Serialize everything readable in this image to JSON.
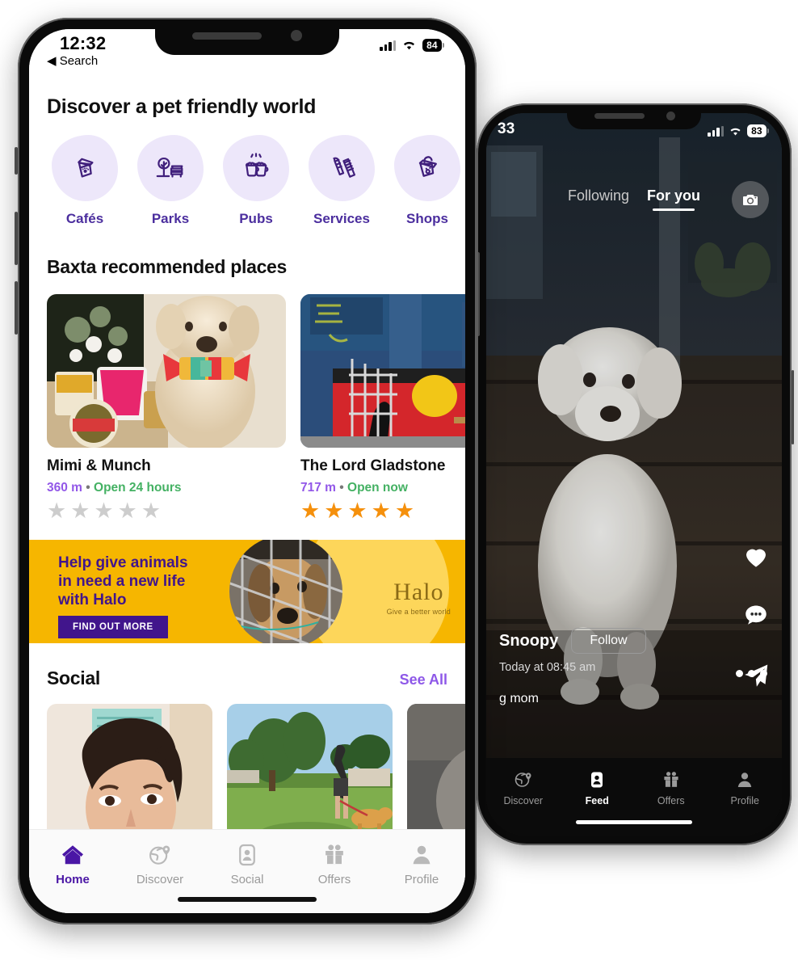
{
  "phone1": {
    "status": {
      "time": "12:32",
      "back_label": "◀ Search",
      "battery": "84",
      "wifi_icon": "wifi-icon",
      "signal_icon": "cellular-signal-icon"
    },
    "header_title": "Discover a pet friendly world",
    "categories": [
      {
        "label": "Cafés",
        "icon": "coffee-cup-paw-icon"
      },
      {
        "label": "Parks",
        "icon": "tree-bench-icon"
      },
      {
        "label": "Pubs",
        "icon": "beer-cheers-icon"
      },
      {
        "label": "Services",
        "icon": "grooming-brush-comb-icon"
      },
      {
        "label": "Shops",
        "icon": "shopping-bag-face-icon"
      }
    ],
    "recommended_title": "Baxta recommended places",
    "places": [
      {
        "name": "Mimi & Munch",
        "distance": "360 m",
        "separator": "•",
        "status": "Open 24 hours",
        "rating": 0,
        "image_alt": "white-poodle-with-rainbow-bowtie"
      },
      {
        "name": "The Lord Gladstone",
        "distance": "717 m",
        "separator": "•",
        "status": "Open now",
        "rating": 5,
        "image_alt": "pub-exterior-with-aboriginal-flag-mural"
      }
    ],
    "banner": {
      "line1": "Help give animals",
      "line2": "in need a new life",
      "line3": "with Halo",
      "cta": "FIND OUT MORE",
      "logo_word": "Halo",
      "logo_tagline": "Give a better world",
      "bg_color": "#F6B600",
      "text_color": "#41158C",
      "image_alt": "beagle-dog-behind-wire-cage"
    },
    "social": {
      "title": "Social",
      "see_all": "See All",
      "posts": [
        {
          "image_alt": "woman-selfie-portrait"
        },
        {
          "image_alt": "woman-walking-golden-dog-in-park"
        },
        {
          "image_alt": "third-post-partially-visible"
        }
      ]
    },
    "tabs": [
      {
        "label": "Home",
        "icon": "home-icon",
        "active": true
      },
      {
        "label": "Discover",
        "icon": "globe-pin-icon",
        "active": false
      },
      {
        "label": "Social",
        "icon": "contact-card-icon",
        "active": false
      },
      {
        "label": "Offers",
        "icon": "gift-icon",
        "active": false
      },
      {
        "label": "Profile",
        "icon": "person-icon",
        "active": false
      }
    ]
  },
  "phone2": {
    "status": {
      "time": "33",
      "battery": "83",
      "wifi_icon": "wifi-icon",
      "signal_icon": "cellular-signal-icon"
    },
    "feed_tabs": [
      {
        "label": "Following",
        "active": false
      },
      {
        "label": "For you",
        "active": true
      }
    ],
    "camera_button": "camera-icon",
    "post": {
      "username": "Snoopy",
      "follow_label": "Follow",
      "timestamp": "Today at 08:45 am",
      "caption": "g mom",
      "image_alt": "white-fluffy-dog-on-wooden-deck"
    },
    "actions": [
      {
        "icon": "heart-icon",
        "name": "like-button"
      },
      {
        "icon": "comment-bubble-icon",
        "name": "comment-button"
      },
      {
        "icon": "paper-plane-icon",
        "name": "share-button"
      }
    ],
    "more_button": "ellipsis-icon",
    "tabs": [
      {
        "label": "Discover",
        "icon": "globe-pin-icon",
        "active": false
      },
      {
        "label": "Feed",
        "icon": "contact-card-icon",
        "active": true
      },
      {
        "label": "Offers",
        "icon": "gift-icon",
        "active": false
      },
      {
        "label": "Profile",
        "icon": "person-icon",
        "active": false
      }
    ]
  },
  "colors": {
    "purple": "#4B2E9E",
    "light_purple": "#8E58E8",
    "green": "#44B163",
    "orange": "#F5900C",
    "yellow": "#F6B600"
  }
}
